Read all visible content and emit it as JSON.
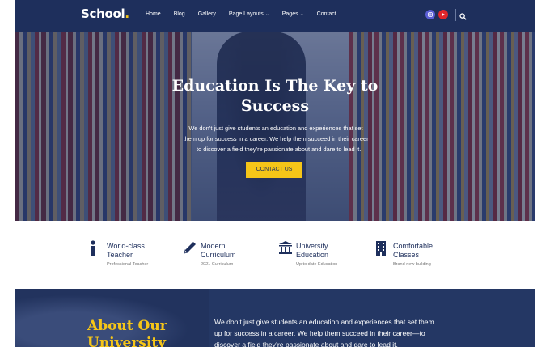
{
  "header": {
    "logo_text": "School",
    "logo_dot": ".",
    "nav": [
      "Home",
      "Blog",
      "Gallery",
      "Page Layouts",
      "Pages",
      "Contact"
    ],
    "nav_dropdown_marker": "⌄",
    "social_icons": [
      "instagram-icon",
      "youtube-icon"
    ],
    "search_icon": "search-icon"
  },
  "hero": {
    "title_line1": "Education Is The Key to",
    "title_line2": "Success",
    "text_line1": "We don’t just give students an education and experiences that set",
    "text_line2": "them up for success in a career. We help them succeed in their career",
    "text_line3": "—to discover a field they’re passionate about and dare to lead it.",
    "cta_label": "CONTACT US"
  },
  "features": [
    {
      "icon": "person-icon",
      "title_line1": "World-class",
      "title_line2": "Teacher",
      "subtitle": "Professional Teacher"
    },
    {
      "icon": "pencil-icon",
      "title_line1": "Modern",
      "title_line2": "Curriculum",
      "subtitle": "2021 Curriculum"
    },
    {
      "icon": "university-icon",
      "title_line1": "University",
      "title_line2": "Education",
      "subtitle": "Up to date Education"
    },
    {
      "icon": "building-icon",
      "title_line1": "Comfortable",
      "title_line2": "Classes",
      "subtitle": "Brand new building"
    }
  ],
  "about": {
    "title_line1": "About Our",
    "title_line2": "University",
    "text_line1": "We don’t just give students an education and experiences that set them",
    "text_line2": "up for success in a career. We help them succeed in their career—to",
    "text_line3": "discover a field they’re passionate about and dare to lead it."
  },
  "colors": {
    "navy": "#1e2f5c",
    "accent": "#f5c518"
  }
}
